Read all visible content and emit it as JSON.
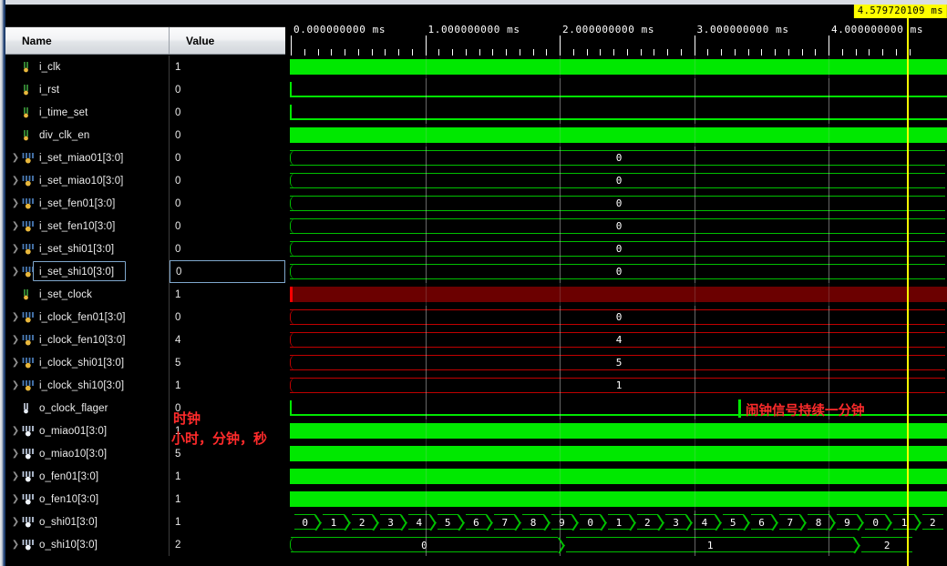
{
  "panel": {
    "name_header": "Name",
    "value_header": "Value"
  },
  "signals": [
    {
      "name": "i_clk",
      "value": "1",
      "kind": "bit",
      "dir": "in",
      "expandable": false,
      "wave": "solid-green",
      "selected": false
    },
    {
      "name": "i_rst",
      "value": "0",
      "kind": "bit",
      "dir": "in",
      "expandable": false,
      "wave": "low-green",
      "selected": false
    },
    {
      "name": "i_time_set",
      "value": "0",
      "kind": "bit",
      "dir": "in",
      "expandable": false,
      "wave": "low-green",
      "selected": false
    },
    {
      "name": "div_clk_en",
      "value": "0",
      "kind": "bit",
      "dir": "in",
      "expandable": false,
      "wave": "solid-green",
      "selected": false
    },
    {
      "name": "i_set_miao01[3:0]",
      "value": "0",
      "kind": "bus",
      "dir": "in",
      "expandable": true,
      "wave": "bus-green",
      "bus_value": "0",
      "selected": false
    },
    {
      "name": "i_set_miao10[3:0]",
      "value": "0",
      "kind": "bus",
      "dir": "in",
      "expandable": true,
      "wave": "bus-green",
      "bus_value": "0",
      "selected": false
    },
    {
      "name": "i_set_fen01[3:0]",
      "value": "0",
      "kind": "bus",
      "dir": "in",
      "expandable": true,
      "wave": "bus-green",
      "bus_value": "0",
      "selected": false
    },
    {
      "name": "i_set_fen10[3:0]",
      "value": "0",
      "kind": "bus",
      "dir": "in",
      "expandable": true,
      "wave": "bus-green",
      "bus_value": "0",
      "selected": false
    },
    {
      "name": "i_set_shi01[3:0]",
      "value": "0",
      "kind": "bus",
      "dir": "in",
      "expandable": true,
      "wave": "bus-green",
      "bus_value": "0",
      "selected": false
    },
    {
      "name": "i_set_shi10[3:0]",
      "value": "0",
      "kind": "bus",
      "dir": "in",
      "expandable": true,
      "wave": "bus-green",
      "bus_value": "0",
      "selected": true
    },
    {
      "name": "i_set_clock",
      "value": "1",
      "kind": "bit",
      "dir": "in",
      "expandable": false,
      "wave": "solid-red",
      "selected": false
    },
    {
      "name": "i_clock_fen01[3:0]",
      "value": "0",
      "kind": "bus",
      "dir": "in",
      "expandable": true,
      "wave": "bus-red",
      "bus_value": "0",
      "selected": false
    },
    {
      "name": "i_clock_fen10[3:0]",
      "value": "4",
      "kind": "bus",
      "dir": "in",
      "expandable": true,
      "wave": "bus-red",
      "bus_value": "4",
      "selected": false
    },
    {
      "name": "i_clock_shi01[3:0]",
      "value": "5",
      "kind": "bus",
      "dir": "in",
      "expandable": true,
      "wave": "bus-red",
      "bus_value": "5",
      "selected": false
    },
    {
      "name": "i_clock_shi10[3:0]",
      "value": "1",
      "kind": "bus",
      "dir": "in",
      "expandable": true,
      "wave": "bus-red",
      "bus_value": "1",
      "selected": false
    },
    {
      "name": "o_clock_flager",
      "value": "0",
      "kind": "bit",
      "dir": "out",
      "expandable": false,
      "wave": "low-green",
      "selected": false
    },
    {
      "name": "o_miao01[3:0]",
      "value": "1",
      "kind": "bus",
      "dir": "out",
      "expandable": true,
      "wave": "solid-green",
      "selected": false
    },
    {
      "name": "o_miao10[3:0]",
      "value": "5",
      "kind": "bus",
      "dir": "out",
      "expandable": true,
      "wave": "solid-green",
      "selected": false
    },
    {
      "name": "o_fen01[3:0]",
      "value": "1",
      "kind": "bus",
      "dir": "out",
      "expandable": true,
      "wave": "solid-green",
      "selected": false
    },
    {
      "name": "o_fen10[3:0]",
      "value": "1",
      "kind": "bus",
      "dir": "out",
      "expandable": true,
      "wave": "solid-green",
      "selected": false
    },
    {
      "name": "o_shi01[3:0]",
      "value": "1",
      "kind": "bus",
      "dir": "out",
      "expandable": true,
      "wave": "counter",
      "selected": false
    },
    {
      "name": "o_shi10[3:0]",
      "value": "2",
      "kind": "bus",
      "dir": "out",
      "expandable": true,
      "wave": "slowbus",
      "selected": false
    }
  ],
  "annotations": {
    "value_note_1": "时钟",
    "value_note_2": "小时，分钟，秒",
    "wave_note": "闹钟信号持续一分钟"
  },
  "timeline": {
    "unit": "ms",
    "ticks": [
      {
        "label": "0.000000000 ms",
        "time": 0.0
      },
      {
        "label": "1.000000000 ms",
        "time": 1.0
      },
      {
        "label": "2.000000000 ms",
        "time": 2.0
      },
      {
        "label": "3.000000000 ms",
        "time": 3.0
      },
      {
        "label": "4.000000000 ms",
        "time": 4.0
      }
    ],
    "minor_per_major": 10,
    "start_time": 0.0,
    "end_time": 4.65
  },
  "cursor": {
    "label": "4.579720109 ms",
    "time": 4.579720109
  },
  "counter_row": {
    "digits": [
      "0",
      "1",
      "2",
      "3",
      "4",
      "5",
      "6",
      "7",
      "8",
      "9",
      "0",
      "1",
      "2",
      "3",
      "4",
      "5",
      "6",
      "7",
      "8",
      "9",
      "0",
      "1",
      "2"
    ]
  },
  "slow_row": {
    "segments": [
      {
        "value": "0",
        "start": 0.0,
        "end": 2.02
      },
      {
        "value": "1",
        "start": 2.02,
        "end": 4.22
      },
      {
        "value": "2",
        "start": 4.22,
        "end": 4.65
      }
    ]
  },
  "colors": {
    "signal_green": "#00e800",
    "signal_red": "#c00000",
    "alarm_fill": "#6b0000",
    "cursor_yellow": "#ffff00",
    "note_red": "#ff2b2b",
    "background": "#000000"
  }
}
